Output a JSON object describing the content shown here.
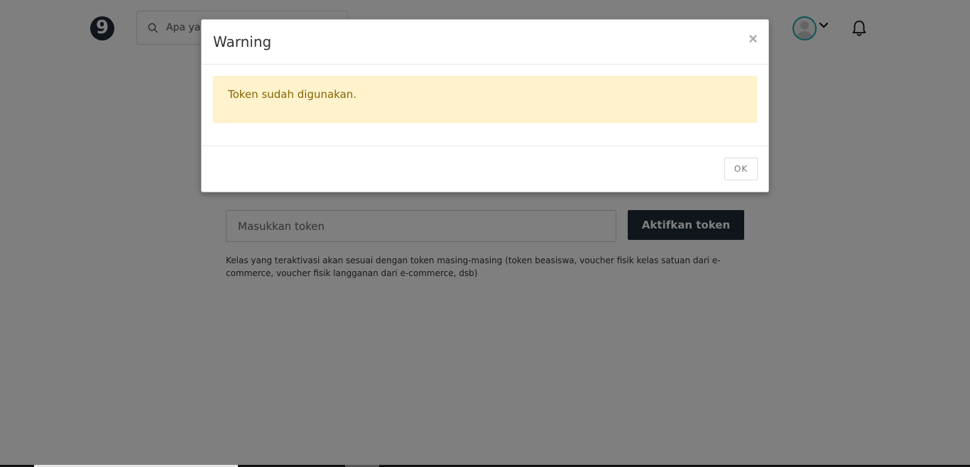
{
  "header": {
    "logo_text": "9",
    "search_placeholder": "Apa yang ingin kamu pelajari?"
  },
  "main": {
    "token_input_placeholder": "Masukkan token",
    "activate_button_label": "Aktifkan token",
    "helper_text": "Kelas yang teraktivasi akan sesuai dengan token masing-masing (token beasiswa, voucher fisik kelas satuan dari e-commerce, voucher fisik langganan dari e-commerce, dsb)"
  },
  "modal": {
    "title": "Warning",
    "close_glyph": "×",
    "message": "Token sudah digunakan.",
    "ok_label": "OK"
  },
  "colors": {
    "brand_dark": "#1f2a37",
    "avatar_ring": "#1aa7a7",
    "alert_bg": "#fff3cd",
    "alert_text": "#856404"
  }
}
